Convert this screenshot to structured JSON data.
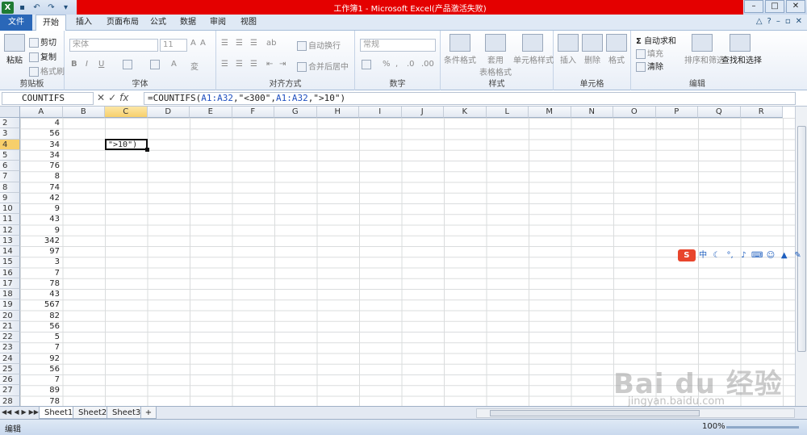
{
  "window": {
    "title": "工作簿1 - Microsoft Excel(产品激活失败)"
  },
  "ribbon_tabs": [
    {
      "label": "文件"
    },
    {
      "label": "开始"
    },
    {
      "label": "插入"
    },
    {
      "label": "页面布局"
    },
    {
      "label": "公式"
    },
    {
      "label": "数据"
    },
    {
      "label": "审阅"
    },
    {
      "label": "视图"
    }
  ],
  "ribbon": {
    "clipboard": {
      "paste": "粘贴",
      "cut": "剪切",
      "copy": "复制",
      "format_painter": "格式刷",
      "label": "剪贴板"
    },
    "font": {
      "name": "宋体",
      "size": "11",
      "label": "字体"
    },
    "alignment": {
      "wrap": "自动换行",
      "merge": "合并后居中",
      "label": "对齐方式"
    },
    "number": {
      "format": "常规",
      "label": "数字"
    },
    "styles": {
      "conditional": "条件格式",
      "table_top": "套用",
      "table_bottom": "表格格式",
      "cell_styles": "单元格样式",
      "label": "样式"
    },
    "cells": {
      "insert": "插入",
      "delete": "删除",
      "format": "格式",
      "label": "单元格"
    },
    "editing": {
      "autosum": "自动求和",
      "fill": "填充",
      "clear": "清除",
      "sort": "排序和筛选",
      "find": "查找和选择",
      "label": "编辑"
    }
  },
  "formula_bar": {
    "name_box": "COUNTIFS",
    "formula_prefix": "=COUNTIFS(",
    "ref1": "A1:A32",
    "mid1": ",\"<300\",",
    "ref2": "A1:A32",
    "suffix": ",\">10\")"
  },
  "columns": [
    "A",
    "B",
    "C",
    "D",
    "E",
    "F",
    "G",
    "H",
    "I",
    "J",
    "K",
    "L",
    "M",
    "N",
    "O",
    "P",
    "Q",
    "R"
  ],
  "rows": [
    {
      "row": "2",
      "a": "4"
    },
    {
      "row": "3",
      "a": "56"
    },
    {
      "row": "4",
      "a": "34"
    },
    {
      "row": "5",
      "a": "34"
    },
    {
      "row": "6",
      "a": "76"
    },
    {
      "row": "7",
      "a": "8"
    },
    {
      "row": "8",
      "a": "74"
    },
    {
      "row": "9",
      "a": "42"
    },
    {
      "row": "10",
      "a": "9"
    },
    {
      "row": "11",
      "a": "43"
    },
    {
      "row": "12",
      "a": "9"
    },
    {
      "row": "13",
      "a": "342"
    },
    {
      "row": "14",
      "a": "97"
    },
    {
      "row": "15",
      "a": "3"
    },
    {
      "row": "16",
      "a": "7"
    },
    {
      "row": "17",
      "a": "78"
    },
    {
      "row": "18",
      "a": "43"
    },
    {
      "row": "19",
      "a": "567"
    },
    {
      "row": "20",
      "a": "82"
    },
    {
      "row": "21",
      "a": "56"
    },
    {
      "row": "22",
      "a": "5"
    },
    {
      "row": "23",
      "a": "7"
    },
    {
      "row": "24",
      "a": "92"
    },
    {
      "row": "25",
      "a": "56"
    },
    {
      "row": "26",
      "a": "7"
    },
    {
      "row": "27",
      "a": "89"
    },
    {
      "row": "28",
      "a": "78"
    }
  ],
  "active_cell_text": "\">10\")",
  "sheet_tabs": [
    "Sheet1",
    "Sheet2",
    "Sheet3"
  ],
  "status": {
    "mode": "编辑",
    "zoom": "100%"
  },
  "watermark": {
    "brand": "Bai du 经验",
    "url": "jingyan.baidu.com"
  },
  "ime_toolbar": {
    "logo": "S",
    "mode": "中"
  }
}
